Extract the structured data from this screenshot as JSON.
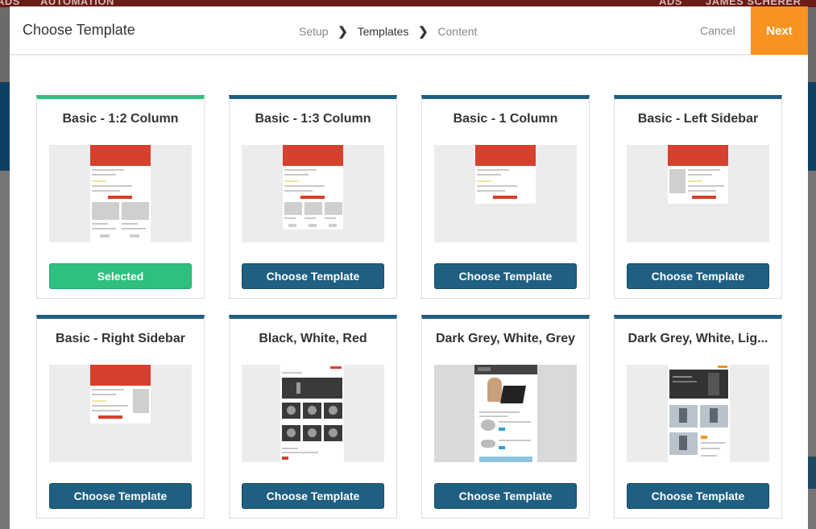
{
  "background": {
    "topbar_left": "ADS",
    "topbar_left2": "AUTOMATION",
    "topbar_right": "ADS",
    "topbar_right2": "JAMES SCHERER"
  },
  "modal": {
    "title": "Choose Template",
    "steps": [
      "Setup",
      "Templates",
      "Content"
    ],
    "active_step": "Templates",
    "cancel_label": "Cancel",
    "next_label": "Next"
  },
  "colors": {
    "accent_orange": "#f7931e",
    "primary_blue": "#1f5f82",
    "selected_green": "#2fbf7f",
    "template_red": "#d6402e"
  },
  "templates": [
    {
      "title": "Basic - 1:2 Column",
      "button": "Selected",
      "selected": true
    },
    {
      "title": "Basic - 1:3 Column",
      "button": "Choose Template",
      "selected": false
    },
    {
      "title": "Basic - 1 Column",
      "button": "Choose Template",
      "selected": false
    },
    {
      "title": "Basic - Left Sidebar",
      "button": "Choose Template",
      "selected": false
    },
    {
      "title": "Basic - Right Sidebar",
      "button": "Choose Template",
      "selected": false
    },
    {
      "title": "Black, White, Red",
      "button": "Choose Template",
      "selected": false
    },
    {
      "title": "Dark Grey, White, Grey",
      "button": "Choose Template",
      "selected": false
    },
    {
      "title": "Dark Grey, White, Lig...",
      "button": "Choose Template",
      "selected": false
    }
  ]
}
